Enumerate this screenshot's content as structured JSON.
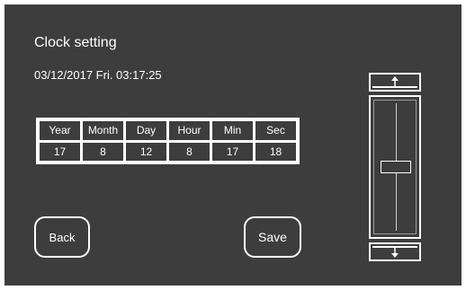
{
  "title": "Clock setting",
  "datetime": "03/12/2017 Fri. 03:17:25",
  "grid": {
    "headers": [
      "Year",
      "Month",
      "Day",
      "Hour",
      "Min",
      "Sec"
    ],
    "values": [
      "17",
      "8",
      "12",
      "8",
      "17",
      "18"
    ]
  },
  "buttons": {
    "back": "Back",
    "save": "Save"
  },
  "slider": {
    "level": 0.5,
    "up_icon": "arrow-up-icon",
    "down_icon": "arrow-down-icon"
  },
  "colors": {
    "background": "#3d3d3d",
    "foreground": "#ffffff"
  }
}
